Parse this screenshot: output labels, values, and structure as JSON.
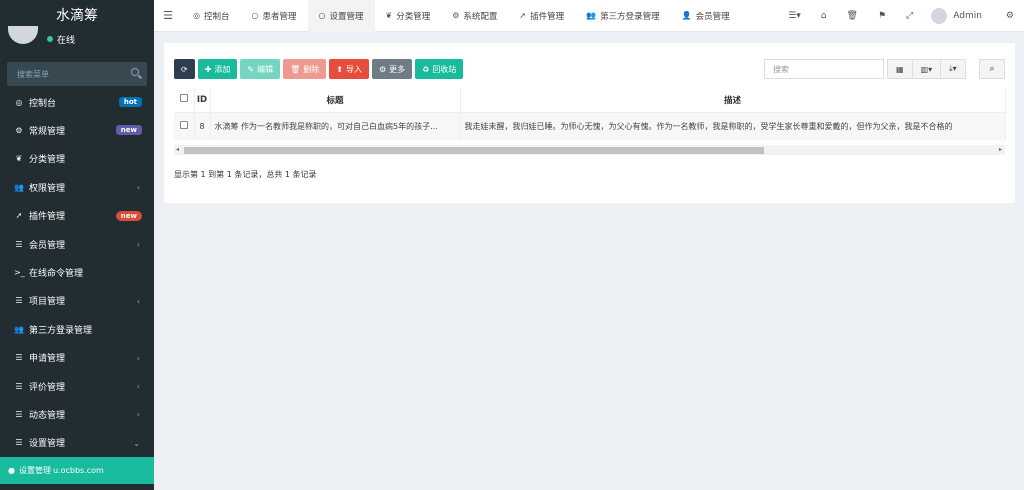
{
  "sidebar": {
    "logo": "水滴筹",
    "status": "在线",
    "search_placeholder": "搜索菜单",
    "items": [
      {
        "icon": "◎",
        "label": "控制台",
        "badge": "hot",
        "badge_class": "hot"
      },
      {
        "icon": "⚙",
        "label": "常规管理",
        "badge": "new",
        "badge_class": "new1"
      },
      {
        "icon": "❦",
        "label": "分类管理"
      },
      {
        "icon": "👥",
        "label": "权限管理",
        "arrow": "‹"
      },
      {
        "icon": "➚",
        "label": "插件管理",
        "badge": "new",
        "badge_class": "new2"
      },
      {
        "icon": "☰",
        "label": "会员管理",
        "arrow": "‹"
      },
      {
        "icon": ">_",
        "label": "在线命令管理"
      },
      {
        "icon": "☰",
        "label": "项目管理",
        "arrow": "‹"
      },
      {
        "icon": "👥",
        "label": "第三方登录管理"
      },
      {
        "icon": "☰",
        "label": "申请管理",
        "arrow": "‹"
      },
      {
        "icon": "☰",
        "label": "评价管理",
        "arrow": "‹"
      },
      {
        "icon": "☰",
        "label": "动态管理",
        "arrow": "‹"
      },
      {
        "icon": "☰",
        "label": "设置管理",
        "arrow": "⌄"
      }
    ],
    "active_sub": "设置管理",
    "active_sub_overlay": "u.ocbbs.com"
  },
  "topnav": {
    "tabs": [
      {
        "icon": "◎",
        "label": "控制台"
      },
      {
        "icon": "○",
        "label": "患者管理"
      },
      {
        "icon": "○",
        "label": "设置管理",
        "active": true
      },
      {
        "icon": "❦",
        "label": "分类管理"
      },
      {
        "icon": "⚙",
        "label": "系统配置"
      },
      {
        "icon": "➚",
        "label": "插件管理"
      },
      {
        "icon": "👥",
        "label": "第三方登录管理"
      },
      {
        "icon": "👤",
        "label": "会员管理"
      }
    ],
    "admin": "Admin"
  },
  "toolbar": {
    "refresh": "",
    "add": "添加",
    "edit": "编辑",
    "delete": "删除",
    "import": "导入",
    "more": "更多",
    "recycle": "回收站",
    "search_placeholder": "搜索"
  },
  "table": {
    "headers": [
      "ID",
      "标题",
      "描述"
    ],
    "rows": [
      {
        "id": "8",
        "title": "水滴筹 作为一名教师我是称职的，可对自己白血病5年的孩子...",
        "desc": "我走娃未醒，我归娃已睡。为师心无愧，为父心有愧。作为一名教师，我是称职的，受学生家长尊重和爱戴的，但作为父亲，我是不合格的"
      }
    ]
  },
  "footer": {
    "info": "显示第 1 到第 1 条记录，总共 1 条记录"
  }
}
